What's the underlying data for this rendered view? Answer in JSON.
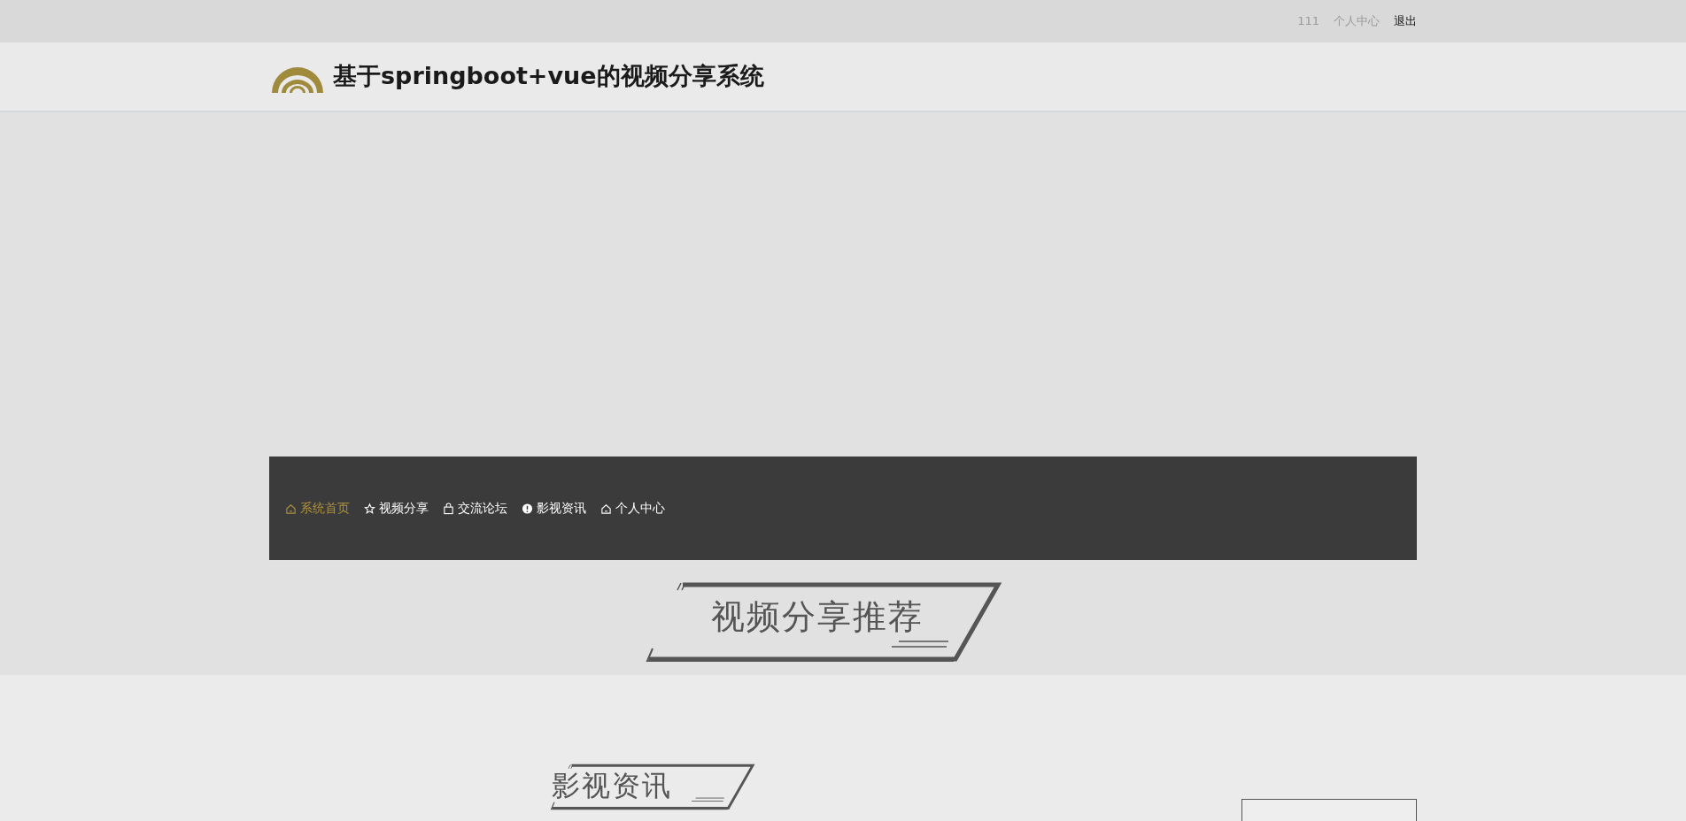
{
  "top_bar": {
    "username": "111",
    "links": [
      {
        "label": "个人中心",
        "kind": "muted"
      },
      {
        "label": "退出",
        "kind": "strong"
      }
    ]
  },
  "header": {
    "title": "基于springboot+vue的视频分享系统"
  },
  "nav": {
    "items": [
      {
        "label": "系统首页",
        "kind": "home",
        "selected": true
      },
      {
        "label": "视频分享",
        "kind": "star",
        "selected": false
      },
      {
        "label": "交流论坛",
        "kind": "bag",
        "selected": false
      },
      {
        "label": "影视资讯",
        "kind": "info",
        "selected": false
      },
      {
        "label": "个人中心",
        "kind": "home",
        "selected": false
      }
    ]
  },
  "sections": [
    {
      "title": "视频分享推荐"
    },
    {
      "title": "影视资讯"
    }
  ]
}
